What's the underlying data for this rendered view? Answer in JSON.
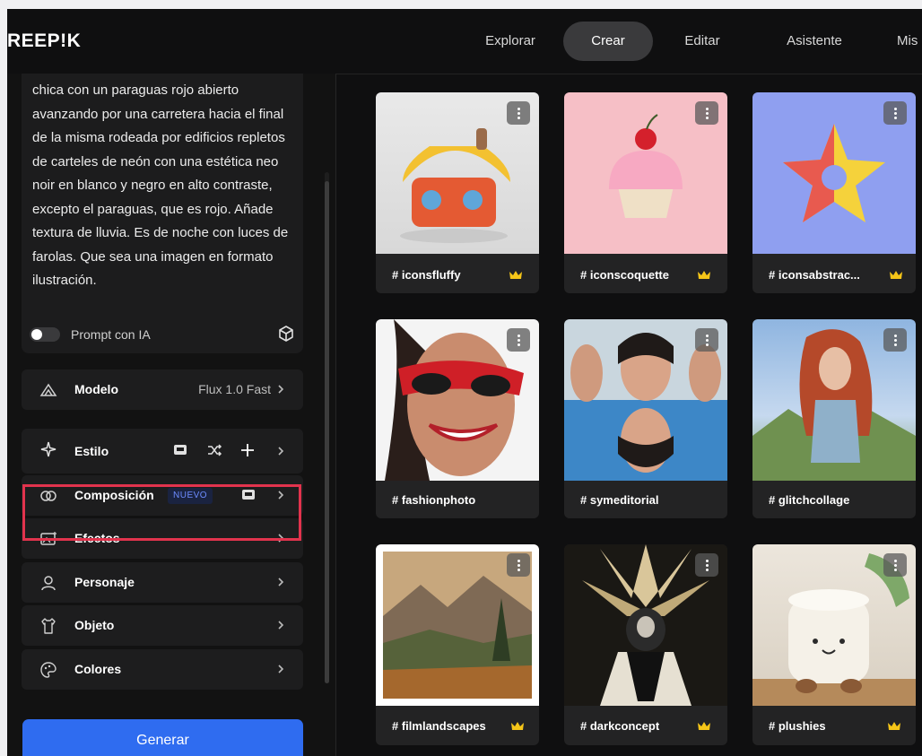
{
  "brand": {
    "logo_text": "REEP!K"
  },
  "nav": {
    "items": [
      "Explorar",
      "Crear",
      "Editar",
      "Asistente",
      "Mis"
    ],
    "active": "Crear"
  },
  "prompt": {
    "text": "chica con un paraguas rojo abierto avanzando por una carretera hacia el final de la misma rodeada por edificios repletos de carteles de neón con una estética neo noir en blanco y negro en alto contraste, excepto el paraguas, que es rojo. Añade textura de lluvia. Es de noche con luces de farolas. Que sea una imagen en formato ilustración.",
    "toggle_label": "Prompt con IA"
  },
  "settings": {
    "modelo": {
      "label": "Modelo",
      "value": "Flux 1.0 Fast"
    },
    "estilo": {
      "label": "Estilo"
    },
    "composicion": {
      "label": "Composición",
      "badge": "NUEVO"
    },
    "efectos": {
      "label": "Efectos"
    },
    "personaje": {
      "label": "Personaje"
    },
    "objeto": {
      "label": "Objeto"
    },
    "colores": {
      "label": "Colores"
    }
  },
  "generate": {
    "label": "Generar"
  },
  "gallery": [
    {
      "tag": "# iconsfluffy",
      "premium": true
    },
    {
      "tag": "# iconscoquette",
      "premium": true
    },
    {
      "tag": "# iconsabstrac...",
      "premium": true
    },
    {
      "tag": "# fashionphoto",
      "premium": false
    },
    {
      "tag": "# symeditorial",
      "premium": false
    },
    {
      "tag": "# glitchcollage",
      "premium": false
    },
    {
      "tag": "# filmlandscapes",
      "premium": true
    },
    {
      "tag": "# darkconcept",
      "premium": true
    },
    {
      "tag": "# plushies",
      "premium": true
    }
  ],
  "colors": {
    "accent": "#2f6cf0",
    "highlight": "#e2334d",
    "crown": "#f5c518"
  }
}
